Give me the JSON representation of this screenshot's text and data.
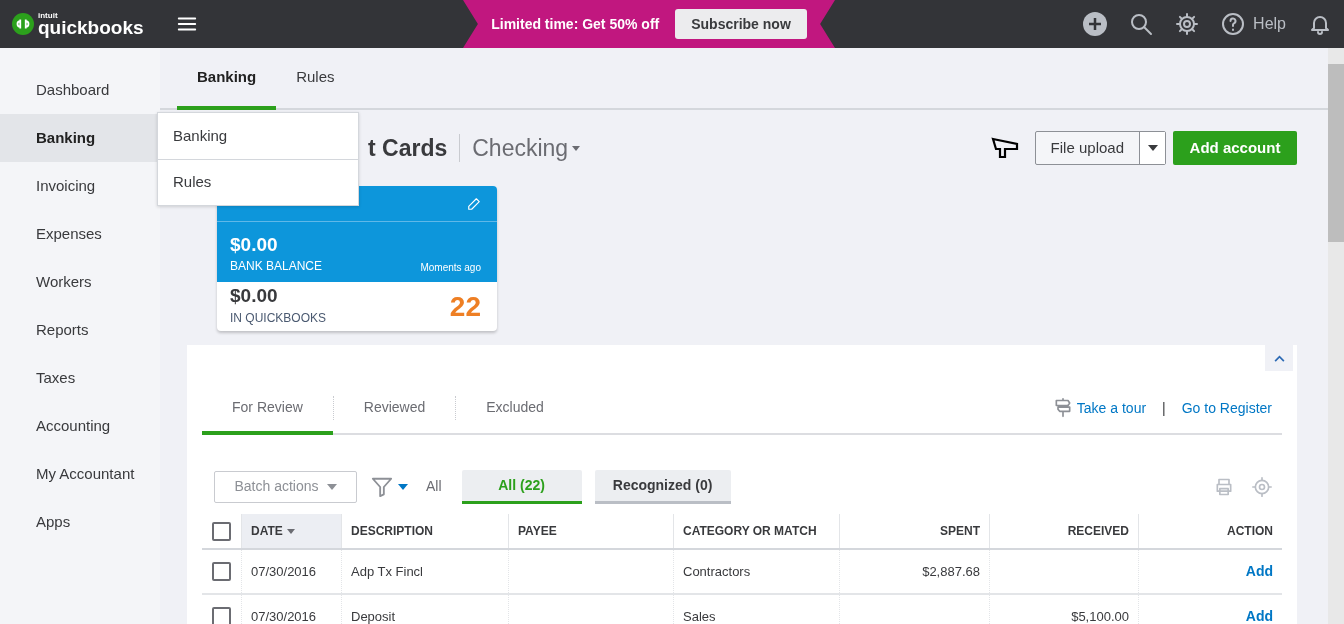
{
  "header": {
    "logo_small": "intuit",
    "logo": "quickbooks",
    "promo": {
      "text": "Limited time: Get 50% off",
      "button": "Subscribe now"
    },
    "help": "Help"
  },
  "sidebar": {
    "items": [
      {
        "label": "Dashboard",
        "selected": false
      },
      {
        "label": "Banking",
        "selected": true
      },
      {
        "label": "Invoicing",
        "selected": false
      },
      {
        "label": "Expenses",
        "selected": false
      },
      {
        "label": "Workers",
        "selected": false
      },
      {
        "label": "Reports",
        "selected": false
      },
      {
        "label": "Taxes",
        "selected": false
      },
      {
        "label": "Accounting",
        "selected": false
      },
      {
        "label": "My Accountant",
        "selected": false
      },
      {
        "label": "Apps",
        "selected": false
      }
    ]
  },
  "flyout": {
    "items": [
      "Banking",
      "Rules"
    ]
  },
  "subtabs": [
    {
      "label": "Banking",
      "selected": true
    },
    {
      "label": "Rules",
      "selected": false
    }
  ],
  "heading": {
    "title": "t Cards",
    "account": "Checking"
  },
  "actions": {
    "file_upload": "File upload",
    "add_account": "Add account"
  },
  "account_card": {
    "bank_balance": "$0.00",
    "bank_label": "BANK BALANCE",
    "updated": "Moments ago",
    "qb_balance": "$0.00",
    "qb_label": "IN QUICKBOOKS",
    "count": "22"
  },
  "review_tabs": [
    {
      "label": "For Review",
      "selected": true
    },
    {
      "label": "Reviewed",
      "selected": false
    },
    {
      "label": "Excluded",
      "selected": false
    }
  ],
  "links": {
    "tour": "Take a tour",
    "separator": "|",
    "register": "Go to Register"
  },
  "toolbar": {
    "batch": "Batch actions",
    "filter_label": "All",
    "pills": [
      {
        "label": "All (22)",
        "selected": true
      },
      {
        "label": "Recognized (0)",
        "selected": false
      }
    ]
  },
  "table": {
    "all_checked": false,
    "columns": [
      {
        "label": "DATE",
        "kind": "text",
        "sorted": true
      },
      {
        "label": "DESCRIPTION",
        "kind": "text",
        "sorted": false
      },
      {
        "label": "PAYEE",
        "kind": "text",
        "sorted": false
      },
      {
        "label": "CATEGORY OR MATCH",
        "kind": "text",
        "sorted": false
      },
      {
        "label": "SPENT",
        "kind": "amount",
        "sorted": false
      },
      {
        "label": "RECEIVED",
        "kind": "amount",
        "sorted": false
      },
      {
        "label": "ACTION",
        "kind": "action",
        "sorted": false
      }
    ],
    "rows": [
      {
        "checked": false,
        "cells": [
          "07/30/2016",
          "Adp Tx Fincl",
          "",
          "Contractors",
          "$2,887.68",
          "",
          "Add"
        ]
      },
      {
        "checked": false,
        "cells": [
          "07/30/2016",
          "Deposit",
          "",
          "Sales",
          "",
          "$5,100.00",
          "Add"
        ]
      }
    ]
  }
}
